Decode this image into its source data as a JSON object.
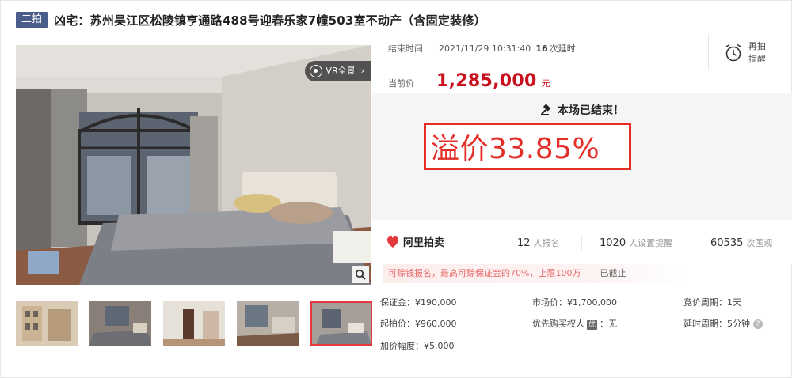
{
  "header": {
    "badge": "二拍",
    "title": "凶宅：苏州吴江区松陵镇亨通路488号迎春乐家7幢503室不动产（含固定装修）"
  },
  "gallery": {
    "vr_label": "VR全景",
    "thumbnails": [
      {
        "icon": "building-exterior-thumbnail"
      },
      {
        "icon": "bedroom-thumbnail"
      },
      {
        "icon": "hallway-thumbnail"
      },
      {
        "icon": "living-room-thumbnail"
      },
      {
        "icon": "main-bedroom-thumbnail",
        "active": true
      }
    ]
  },
  "auction": {
    "end_label": "结束时间",
    "end_time": "2021/11/29 10:31:40",
    "delay_count": "16",
    "delay_text": "次延时",
    "remind_line1": "再拍",
    "remind_line2": "提醒",
    "current_label": "当前价",
    "current_price": "1,285,000",
    "currency": "元",
    "ended_text": "本场已结束！",
    "premium_text": "溢价33.85%"
  },
  "stats": {
    "logo": "阿里拍卖",
    "signup_count": "12",
    "signup_unit": "人报名",
    "remind_count": "1020",
    "remind_unit": "人设置提醒",
    "views_count": "60535",
    "views_unit": "次围观"
  },
  "notice": {
    "text": "可赊钱报名，最高可赊保证金的70%，上限100万",
    "status": "已截止"
  },
  "details": {
    "deposit": "保证金：¥190,000",
    "start_price": "起拍价：¥960,000",
    "increment": "加价幅度：¥5,000",
    "market_price": "市场价：¥1,700,000",
    "priority_label": "优先购买权人",
    "priority_badge": "优",
    "priority_value": "：无",
    "bid_cycle": "竞价周期：1天",
    "delay_cycle": "延时周期：5分钟"
  },
  "colors": {
    "accent_red": "#c8101e",
    "premium_red": "#e52d27",
    "badge_blue": "#4a5d8a"
  }
}
